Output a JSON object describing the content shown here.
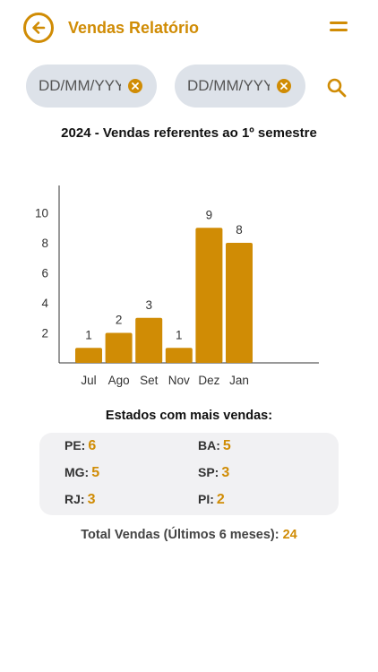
{
  "header": {
    "title": "Vendas Relatório",
    "back_icon": "arrow-left-circle-icon",
    "menu_icon": "menu-icon",
    "accent_color": "#d08c05"
  },
  "filters": {
    "start_date": {
      "placeholder": "DD/MM/YYYY",
      "value": ""
    },
    "end_date": {
      "placeholder": "DD/MM/YYYY",
      "value": ""
    },
    "clear_icon": "close-circle-icon",
    "search_icon": "search-icon"
  },
  "chart_title": "2024 - Vendas referentes ao 1º semestre",
  "chart_data": {
    "type": "bar",
    "title": "2024 - Vendas referentes ao 1º semestre",
    "categories": [
      "Jul",
      "Ago",
      "Set",
      "Nov",
      "Dez",
      "Jan"
    ],
    "values": [
      1,
      2,
      3,
      1,
      9,
      8
    ],
    "data_labels": [
      "1",
      "2",
      "3",
      "1",
      "9",
      "8"
    ],
    "yticks": [
      "2",
      "4",
      "6",
      "8",
      "10"
    ],
    "ylim": [
      0,
      12
    ],
    "xlabel": "",
    "ylabel": "",
    "grid": false,
    "bar_color": "#d08c05"
  },
  "states": {
    "title": "Estados com mais vendas:",
    "items": [
      {
        "label": "PE:",
        "value": "6"
      },
      {
        "label": "BA:",
        "value": "5"
      },
      {
        "label": "MG:",
        "value": "5"
      },
      {
        "label": "SP:",
        "value": "3"
      },
      {
        "label": "RJ:",
        "value": "3"
      },
      {
        "label": "PI:",
        "value": "2"
      }
    ]
  },
  "total": {
    "label": "Total Vendas (Últimos 6 meses):",
    "value": "24"
  }
}
